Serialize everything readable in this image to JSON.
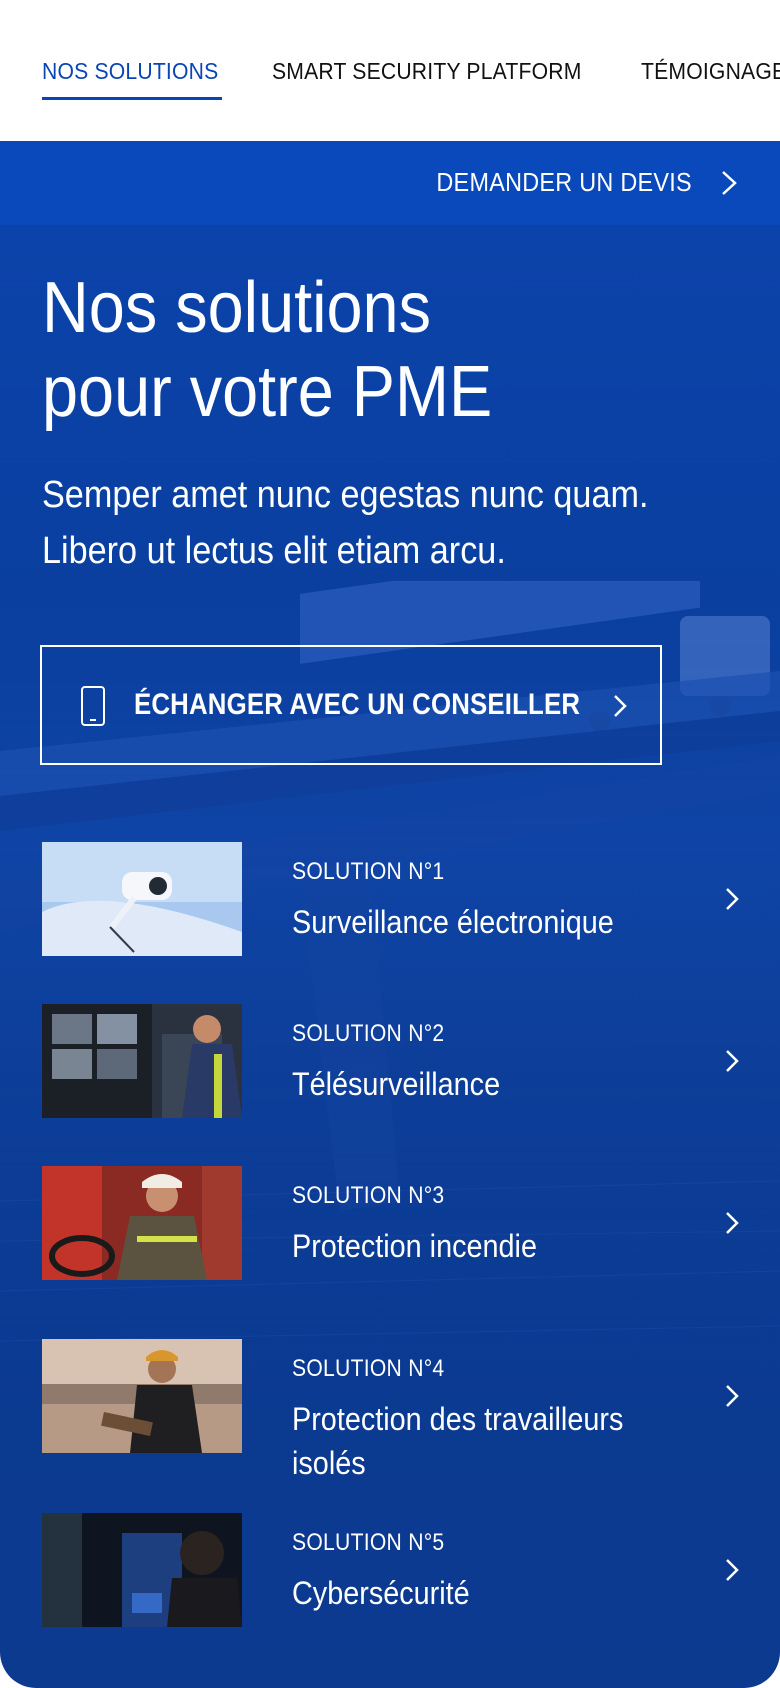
{
  "tabs": [
    {
      "label": "NOS SOLUTIONS",
      "active": true
    },
    {
      "label": "SMART SECURITY PLATFORM",
      "active": false
    },
    {
      "label": "TÉMOIGNAGES",
      "active": false
    }
  ],
  "quote_bar": {
    "label": "DEMANDER UN DEVIS"
  },
  "hero": {
    "title_line1": "Nos solutions",
    "title_line2": "pour votre PME",
    "subtitle_line1": "Semper amet nunc egestas nunc quam.",
    "subtitle_line2": "Libero ut lectus elit etiam arcu."
  },
  "advisor_button": {
    "label": "ÉCHANGER AVEC UN CONSEILLER",
    "icon": "smartphone-icon"
  },
  "solutions": [
    {
      "number": "SOLUTION N°1",
      "name": "Surveillance électronique",
      "image": "security-camera-photo"
    },
    {
      "number": "SOLUTION N°2",
      "name": "Télésurveillance",
      "image": "monitoring-operator-photo"
    },
    {
      "number": "SOLUTION N°3",
      "name": "Protection incendie",
      "image": "firefighter-photo"
    },
    {
      "number": "SOLUTION N°4",
      "name": "Protection des travailleurs isolés",
      "image": "worker-tablet-photo"
    },
    {
      "number": "SOLUTION N°5",
      "name": "Cybersécurité",
      "image": "cyber-analyst-photo"
    }
  ],
  "colors": {
    "accent": "#0a45b5",
    "hero_blue": "#0b3f9f",
    "quote_bar": "#0a49bb",
    "text_light": "#ffffff"
  }
}
